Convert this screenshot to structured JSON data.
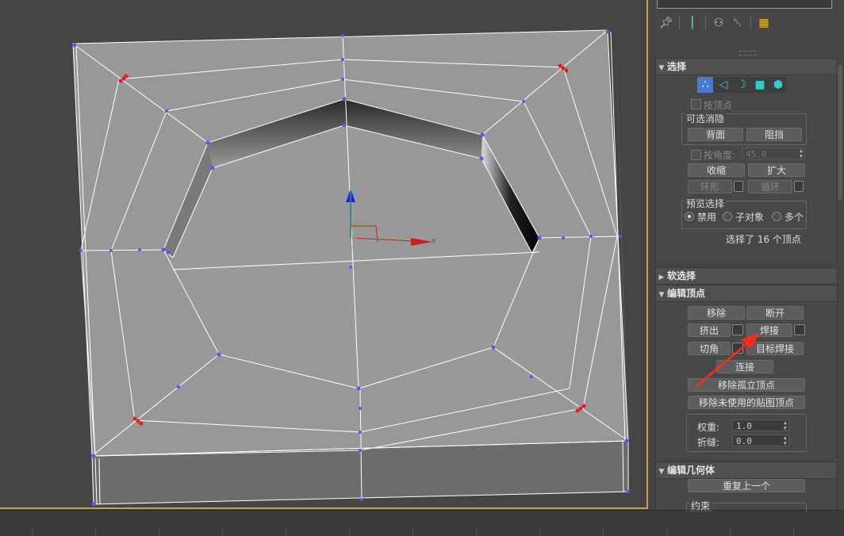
{
  "viewport": {
    "axis_x_label": "x",
    "axis_z_label": "z"
  },
  "command_panel": {
    "toolbar": {
      "icons": [
        "pin-icon",
        "show-end-result-icon",
        "make-unique-icon",
        "remove-modifier-icon",
        "configure-modifier-sets-icon"
      ]
    },
    "selection": {
      "title": "选择",
      "subobject_modes": [
        "vertex-mode-icon",
        "edge-mode-icon",
        "border-mode-icon",
        "polygon-mode-icon",
        "element-mode-icon"
      ],
      "by_vertex_label": "按顶点",
      "backface_group_label": "可选消隐",
      "backface_button": "背面",
      "occluded_button": "阻挡",
      "by_angle_label": "按角度:",
      "by_angle_value": "45.0",
      "shrink_button": "收缩",
      "grow_button": "扩大",
      "ring_button": "环形",
      "loop_button": "循环",
      "preview_group_label": "预览选择",
      "preview_options": [
        "禁用",
        "子对象",
        "多个"
      ],
      "preview_selected": "禁用",
      "status_text": "选择了 16 个顶点"
    },
    "soft_selection": {
      "title": "软选择"
    },
    "edit_vertices": {
      "title": "编辑顶点",
      "remove_button": "移除",
      "break_button": "断开",
      "extrude_button": "挤出",
      "weld_button": "焊接",
      "chamfer_button": "切角",
      "target_weld_button": "目标焊接",
      "connect_button": "连接",
      "remove_isolated_button": "移除孤立顶点",
      "remove_unused_map_button": "移除未使用的贴图顶点",
      "weight_label": "权重:",
      "weight_value": "1.0",
      "crease_label": "折缝:",
      "crease_value": "0.0"
    },
    "edit_geometry": {
      "title": "编辑几何体",
      "repeat_last_button": "重复上一个",
      "constraints_label": "约束"
    }
  }
}
